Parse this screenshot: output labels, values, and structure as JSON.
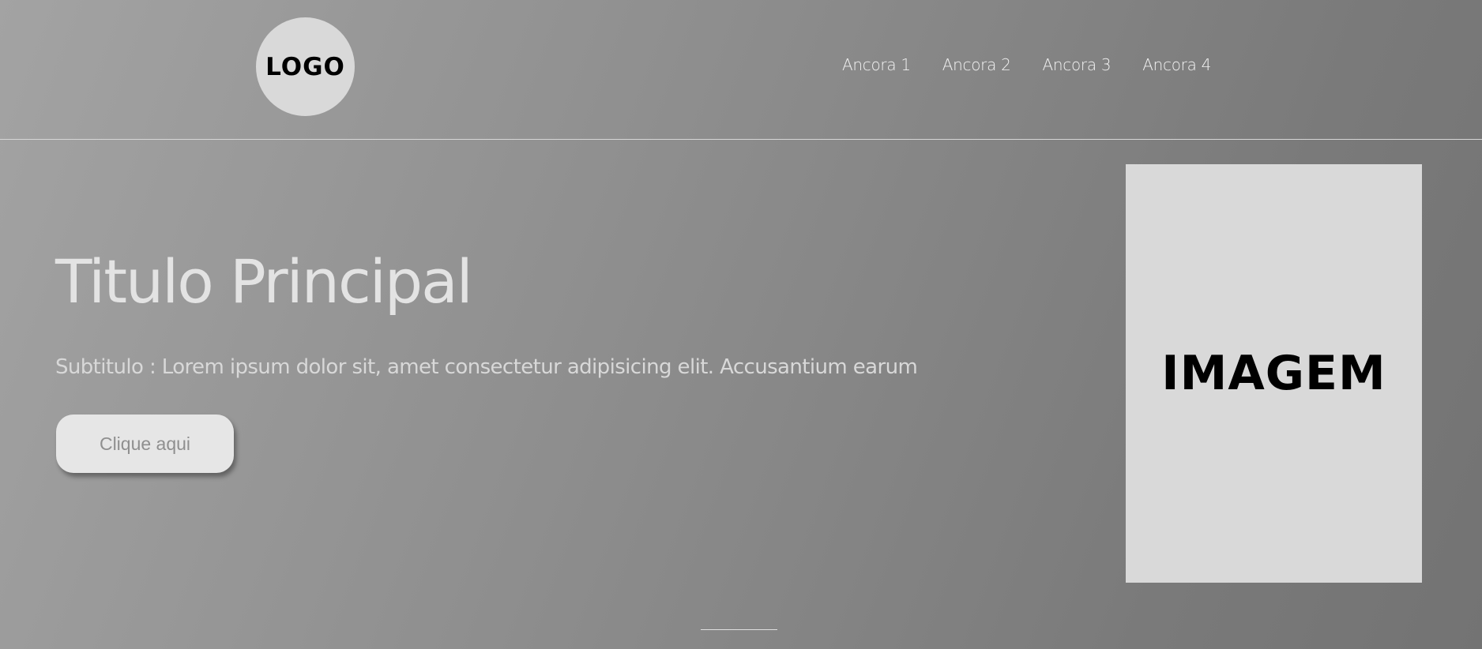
{
  "header": {
    "logo_text": "LOGO",
    "nav": [
      {
        "label": "Ancora 1"
      },
      {
        "label": "Ancora 2"
      },
      {
        "label": "Ancora 3"
      },
      {
        "label": "Ancora 4"
      }
    ]
  },
  "hero": {
    "title": "Titulo Principal",
    "subtitle": "Subtitulo : Lorem ipsum dolor sit, amet consectetur adipisicing elit. Accusantium earum",
    "button_label": "Clique aqui",
    "image_text": "IMAGEM"
  },
  "colors": {
    "background_light": "#a3a3a3",
    "background_dark": "#737373",
    "placeholder": "#d9d9d9",
    "button": "#e6e6e6"
  }
}
